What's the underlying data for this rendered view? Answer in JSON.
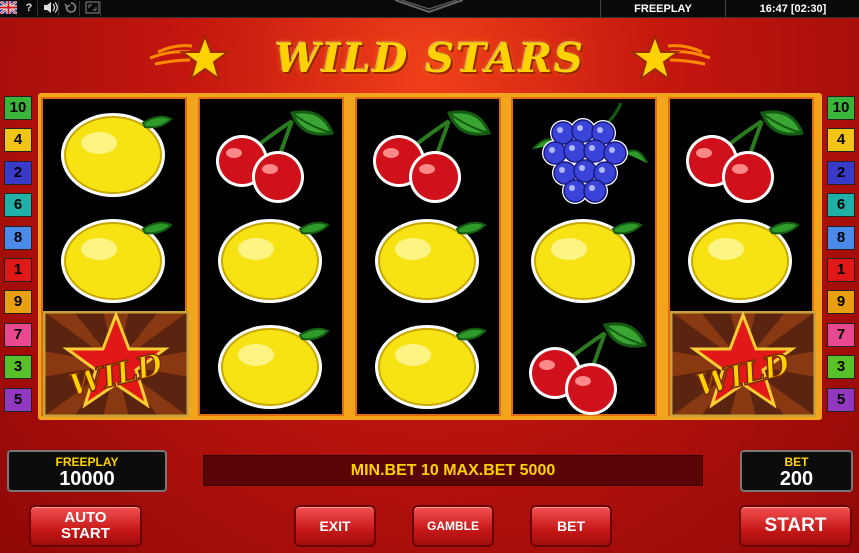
{
  "topbar": {
    "mode": "FREEPLAY",
    "clock": "16:47 [02:30]",
    "icons": [
      "uk-flag-icon",
      "help-icon",
      "sound-icon",
      "history-icon",
      "fullscreen-icon"
    ],
    "help_glyph": "?"
  },
  "title": "WILD STARS",
  "paylines_left": [
    "10",
    "4",
    "2",
    "6",
    "8",
    "1",
    "9",
    "7",
    "3",
    "5"
  ],
  "paylines_right": [
    "10",
    "4",
    "2",
    "6",
    "8",
    "1",
    "9",
    "7",
    "3",
    "5"
  ],
  "payline_colors": {
    "10": "#3ab53a",
    "4": "#f2c418",
    "2": "#3a3ac8",
    "6": "#1fb0a8",
    "8": "#4a8ae8",
    "1": "#e01818",
    "9": "#e8a010",
    "7": "#e84890",
    "3": "#58c028",
    "5": "#9038c0"
  },
  "reels": [
    [
      "lemon",
      "lemon",
      "wild"
    ],
    [
      "cherries",
      "lemon",
      "lemon"
    ],
    [
      "cherries",
      "lemon",
      "lemon"
    ],
    [
      "grapes",
      "lemon",
      "cherries"
    ],
    [
      "cherries",
      "lemon",
      "wild"
    ]
  ],
  "wild_label": "WILD",
  "freeplay": {
    "label": "FREEPLAY",
    "value": "10000"
  },
  "bet": {
    "label": "BET",
    "value": "200"
  },
  "message": "MIN.BET 10 MAX.BET 5000",
  "buttons": {
    "auto_start_line1": "AUTO",
    "auto_start_line2": "START",
    "exit": "EXIT",
    "gamble": "GAMBLE",
    "bet": "BET",
    "start": "START"
  },
  "colors": {
    "accent_yellow": "#ffd200",
    "reel_border": "#f2a51c",
    "button_red": "#c81818"
  }
}
